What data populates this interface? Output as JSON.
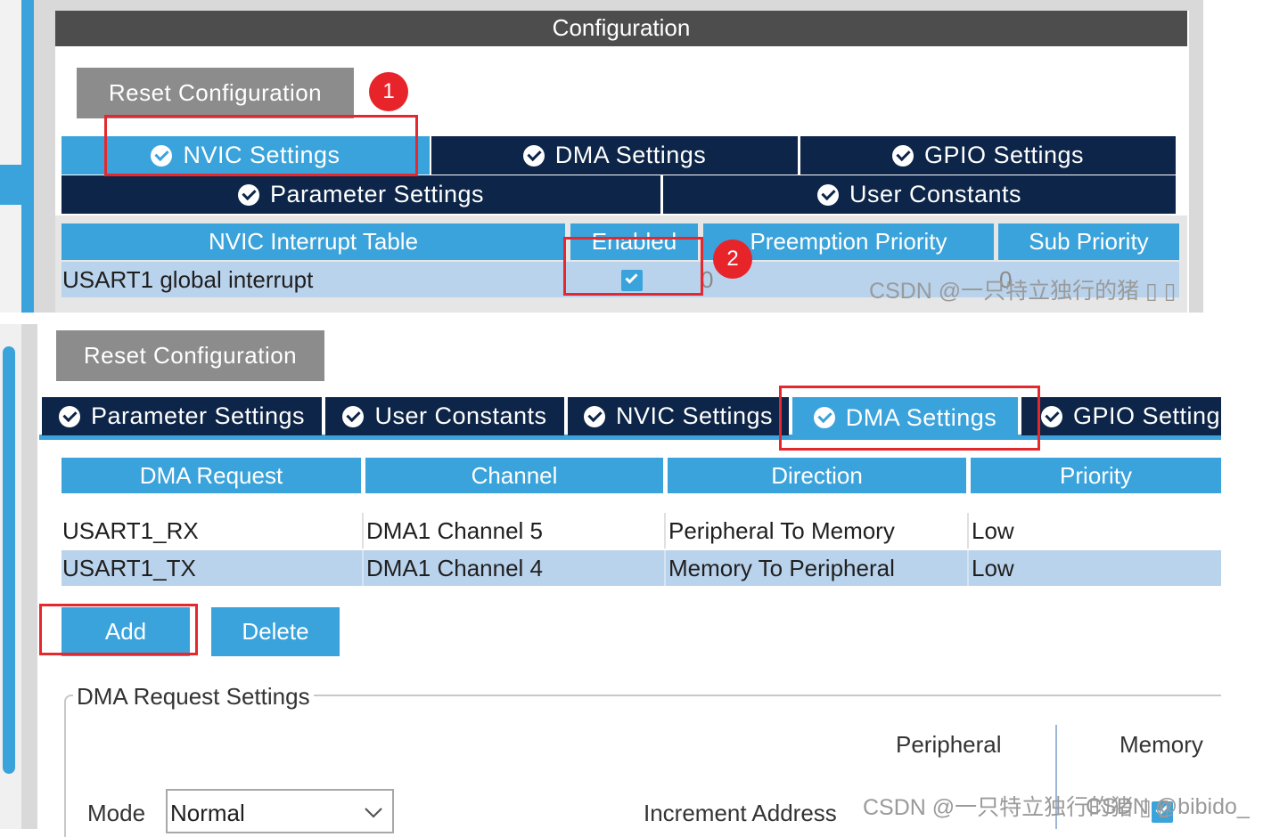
{
  "top_panel": {
    "title": "Configuration",
    "reset_label": "Reset Configuration",
    "tabs_row1": [
      "NVIC Settings",
      "DMA Settings",
      "GPIO Settings"
    ],
    "tabs_row2": [
      "Parameter Settings",
      "User Constants"
    ],
    "table_headers": [
      "NVIC Interrupt Table",
      "Enabled",
      "Preemption Priority",
      "Sub Priority"
    ],
    "row": {
      "name": "USART1 global interrupt",
      "enabled": true,
      "preemption": "0",
      "sub": "0"
    },
    "badge1": "1",
    "badge2": "2",
    "watermark": "CSDN @一只特立独行的猪 ▯ ▯"
  },
  "bottom_panel": {
    "reset_label": "Reset Configuration",
    "tabs": [
      "Parameter Settings",
      "User Constants",
      "NVIC Settings",
      "DMA Settings",
      "GPIO Settings"
    ],
    "table_headers": [
      "DMA Request",
      "Channel",
      "Direction",
      "Priority"
    ],
    "rows": [
      [
        "USART1_RX",
        "DMA1 Channel 5",
        "Peripheral To Memory",
        "Low"
      ],
      [
        "USART1_TX",
        "DMA1 Channel 4",
        "Memory To Peripheral",
        "Low"
      ]
    ],
    "add_label": "Add",
    "delete_label": "Delete",
    "settings_title": "DMA Request Settings",
    "peripheral_label": "Peripheral",
    "memory_label": "Memory",
    "mode_label": "Mode",
    "mode_value": "Normal",
    "increment_label": "Increment Address",
    "watermark": "CSDN @一只特立独行的猪 ▯ ▯",
    "watermark2": "CSDN @bibido_"
  },
  "colors": {
    "tab_dark": "#0d2548",
    "tab_active": "#3aa3db",
    "highlight": "#e5282e"
  }
}
